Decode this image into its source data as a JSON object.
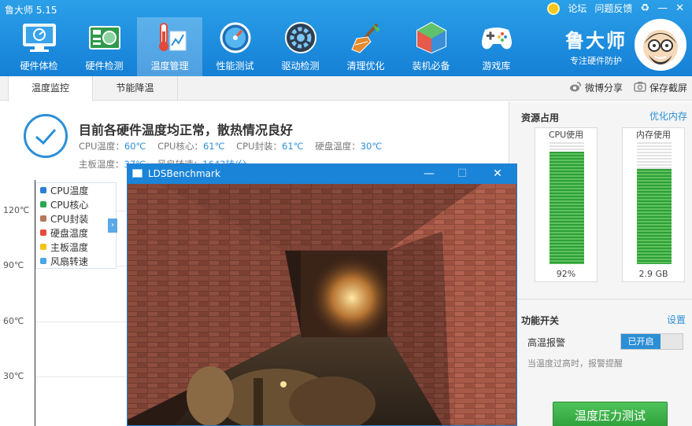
{
  "app": {
    "title": "鲁大师 5.15"
  },
  "top_controls": {
    "forum": "论坛",
    "feedback": "问题反馈",
    "skin_glyph": "♻",
    "minimize_glyph": "—",
    "close_glyph": "✕"
  },
  "nav": {
    "items": [
      {
        "label": "硬件体检",
        "icon": "monitor-icon"
      },
      {
        "label": "硬件检测",
        "icon": "circuit-board-icon"
      },
      {
        "label": "温度管理",
        "icon": "thermometer-icon"
      },
      {
        "label": "性能测试",
        "icon": "speedometer-icon"
      },
      {
        "label": "驱动检测",
        "icon": "gear-icon"
      },
      {
        "label": "清理优化",
        "icon": "broom-icon"
      },
      {
        "label": "装机必备",
        "icon": "cube-icon"
      },
      {
        "label": "游戏库",
        "icon": "gamepad-icon"
      }
    ],
    "active_index": 2
  },
  "brand": {
    "name": "鲁大师",
    "slogan": "专注硬件防护"
  },
  "tabs": {
    "monitor": "温度监控",
    "saving": "节能降温",
    "share": "微博分享",
    "screenshot": "保存截屏"
  },
  "status": {
    "title": "目前各硬件温度均正常，散热情况良好",
    "cpu_temp_label": "CPU温度：",
    "cpu_temp": "60℃",
    "cpu_core_label": "CPU核心：",
    "cpu_core": "61℃",
    "cpu_pkg_label": "CPU封装：",
    "cpu_pkg": "61℃",
    "disk_label": "硬盘温度：",
    "disk": "30℃",
    "board_label": "主板温度：",
    "board": "37℃",
    "fan_label": "风扇转速：",
    "fan": "1643转/分"
  },
  "chart": {
    "y_ticks": [
      "120℃",
      "90℃",
      "60℃",
      "30℃"
    ],
    "legend": [
      {
        "label": "CPU温度",
        "color": "#2c7fd6"
      },
      {
        "label": "CPU核心",
        "color": "#2aa853"
      },
      {
        "label": "CPU封装",
        "color": "#b5785a"
      },
      {
        "label": "硬盘温度",
        "color": "#e64b3c"
      },
      {
        "label": "主板温度",
        "color": "#f3c21a"
      },
      {
        "label": "风扇转速",
        "color": "#4aa6e8"
      }
    ],
    "legend_toggle": "›"
  },
  "resources": {
    "title": "资源占用",
    "optimize": "优化内存",
    "cpu": {
      "label": "CPU使用",
      "value": "92%",
      "fraction": 0.92
    },
    "mem": {
      "label": "内存使用",
      "value": "2.9 GB",
      "fraction": 0.78
    }
  },
  "functions": {
    "title": "功能开关",
    "settings": "设置",
    "high_temp_label": "高温报警",
    "toggle_state": "已开启",
    "hint": "当温度过高时，报警提醒"
  },
  "stress_button": "温度压力测试",
  "benchmark": {
    "title": "LDSBenchmark",
    "minimize": "—",
    "maximize": "☐",
    "close": "✕"
  }
}
